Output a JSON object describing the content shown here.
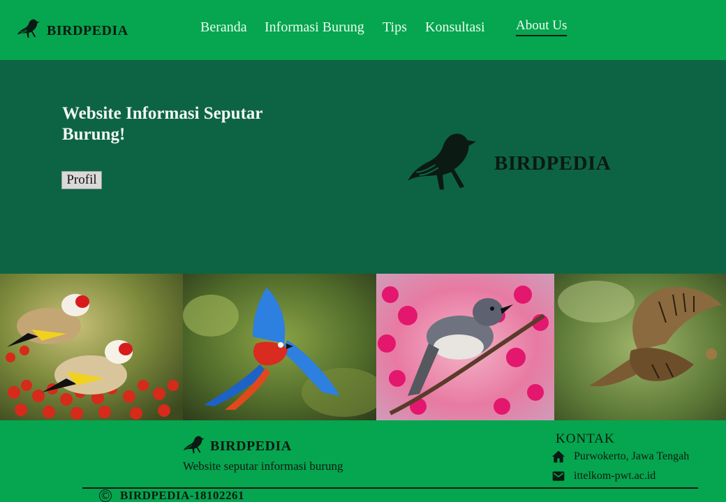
{
  "nav": {
    "brand": "BIRDPEDIA",
    "links": [
      "Beranda",
      "Informasi Burung",
      "Tips",
      "Konsultasi",
      "About Us"
    ],
    "active_link": "About Us"
  },
  "hero": {
    "title": "Website Informasi Seputar Burung!",
    "button_label": "Profil",
    "brand": "BIRDPEDIA"
  },
  "gallery": {
    "images": [
      "goldfinch-photo",
      "macaw-photo",
      "bird-on-blossom-photo",
      "hawk-photo"
    ]
  },
  "footer": {
    "brand": "BIRDPEDIA",
    "tagline": "Website seputar informasi burung",
    "contact_title": "KONTAK",
    "address": "Purwokerto, Jawa Tengah",
    "email": "ittelkom-pwt.ac.id",
    "copyright_symbol": "©",
    "copyright_text": "BIRDPEDIA-18102261"
  },
  "colors": {
    "nav_green": "#06a54f",
    "hero_green": "#0d6444",
    "text_dark": "#0b1a12"
  }
}
